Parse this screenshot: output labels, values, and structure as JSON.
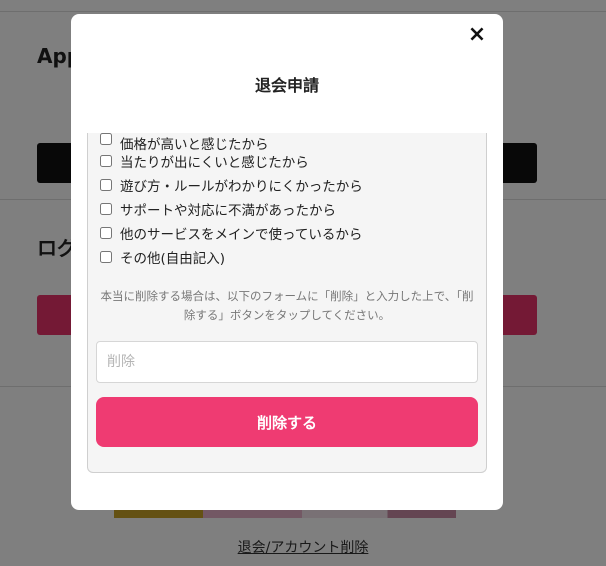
{
  "background": {
    "heading_1": "App",
    "heading_2": "ログ",
    "footer_link": "退会/アカウント削除"
  },
  "modal": {
    "title": "退会申請",
    "close_icon": "×",
    "reasons": [
      "価格が高いと感じたから",
      "当たりが出にくいと感じたから",
      "遊び方・ルールがわかりにくかったから",
      "サポートや対応に不満があったから",
      "他のサービスをメインで使っているから",
      "その他(自由記入)"
    ],
    "note": "本当に削除する場合は、以下のフォームに「削除」と入力した上で、「削除する」ボタンをタップしてください。",
    "input_placeholder": "削除",
    "delete_button": "削除する",
    "accent_color": "#ef3b72"
  }
}
